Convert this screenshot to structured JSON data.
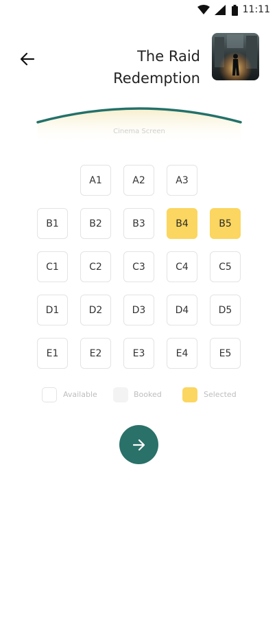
{
  "status_bar": {
    "time": "11:11",
    "icons": [
      "wifi-icon",
      "signal-icon",
      "battery-icon"
    ]
  },
  "header": {
    "back_icon": "arrow-left-icon",
    "title_line1": "The Raid",
    "title_line2": "Redemption",
    "poster": "movie-poster"
  },
  "screen": {
    "label": "Cinema Screen",
    "arc_color": "#23716a"
  },
  "seats": {
    "rows": [
      [
        {
          "id": "A1",
          "state": "available"
        },
        {
          "id": "A2",
          "state": "available"
        },
        {
          "id": "A3",
          "state": "available"
        }
      ],
      [
        {
          "id": "B1",
          "state": "available"
        },
        {
          "id": "B2",
          "state": "available"
        },
        {
          "id": "B3",
          "state": "available"
        },
        {
          "id": "B4",
          "state": "selected"
        },
        {
          "id": "B5",
          "state": "selected"
        }
      ],
      [
        {
          "id": "C1",
          "state": "available"
        },
        {
          "id": "C2",
          "state": "available"
        },
        {
          "id": "C3",
          "state": "available"
        },
        {
          "id": "C4",
          "state": "available"
        },
        {
          "id": "C5",
          "state": "available"
        }
      ],
      [
        {
          "id": "D1",
          "state": "available"
        },
        {
          "id": "D2",
          "state": "available"
        },
        {
          "id": "D3",
          "state": "available"
        },
        {
          "id": "D4",
          "state": "available"
        },
        {
          "id": "D5",
          "state": "available"
        }
      ],
      [
        {
          "id": "E1",
          "state": "available"
        },
        {
          "id": "E2",
          "state": "available"
        },
        {
          "id": "E3",
          "state": "available"
        },
        {
          "id": "E4",
          "state": "available"
        },
        {
          "id": "E5",
          "state": "available"
        }
      ]
    ]
  },
  "legend": {
    "available": "Available",
    "booked": "Booked",
    "selected": "Selected"
  },
  "colors": {
    "accent": "#2a7169",
    "selected": "#fbd660",
    "booked": "#f3f3f3",
    "border": "#e3e3e3"
  },
  "next_button": {
    "icon": "arrow-right-icon"
  }
}
